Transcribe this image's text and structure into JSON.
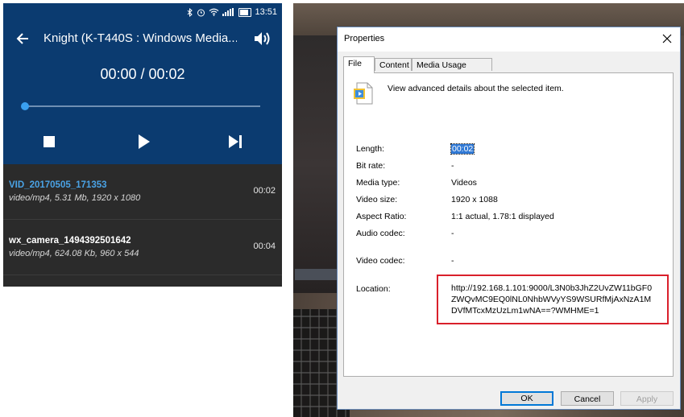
{
  "phone": {
    "status": {
      "time": "13:51"
    },
    "title": "Knight (K-T440S : Windows Media...",
    "time_display": "00:00 / 00:02",
    "progress_fraction": 0.0,
    "videos": [
      {
        "name": "VID_20170505_171353",
        "meta": "video/mp4, 5.31 Mb, 1920 x 1080",
        "duration": "00:02",
        "active": true
      },
      {
        "name": "wx_camera_1494392501642",
        "meta": "video/mp4, 624.08 Kb, 960 x 544",
        "duration": "00:04",
        "active": false
      }
    ],
    "accent_color": "#4aa3e6",
    "header_color": "#0b3b70"
  },
  "dialog": {
    "title": "Properties",
    "tabs": [
      "File",
      "Content",
      "Media Usage Rights"
    ],
    "active_tab": "File",
    "description": "View advanced details about the selected item.",
    "fields": [
      {
        "label": "Length:",
        "value": "00:02"
      },
      {
        "label": "Bit rate:",
        "value": "-"
      },
      {
        "label": "Media type:",
        "value": "Videos"
      },
      {
        "label": "Video size:",
        "value": "1920 x 1088"
      },
      {
        "label": "Aspect Ratio:",
        "value": "1:1 actual, 1.78:1 displayed"
      },
      {
        "label": "Audio codec:",
        "value": "-"
      },
      {
        "label": "Video codec:",
        "value": "-"
      },
      {
        "label": "Location:",
        "value": "http://192.168.1.101:9000/L3N0b3JhZ2UvZW11bGF0ZWQvMC9EQ0lNL0NhbWVyYS9WSURfMjAxNzA1MDVfMTcxMzUzLm1wNA==?WMHME=1"
      }
    ],
    "buttons": {
      "ok": "OK",
      "cancel": "Cancel",
      "apply": "Apply"
    },
    "highlight_color": "#d9202b"
  }
}
